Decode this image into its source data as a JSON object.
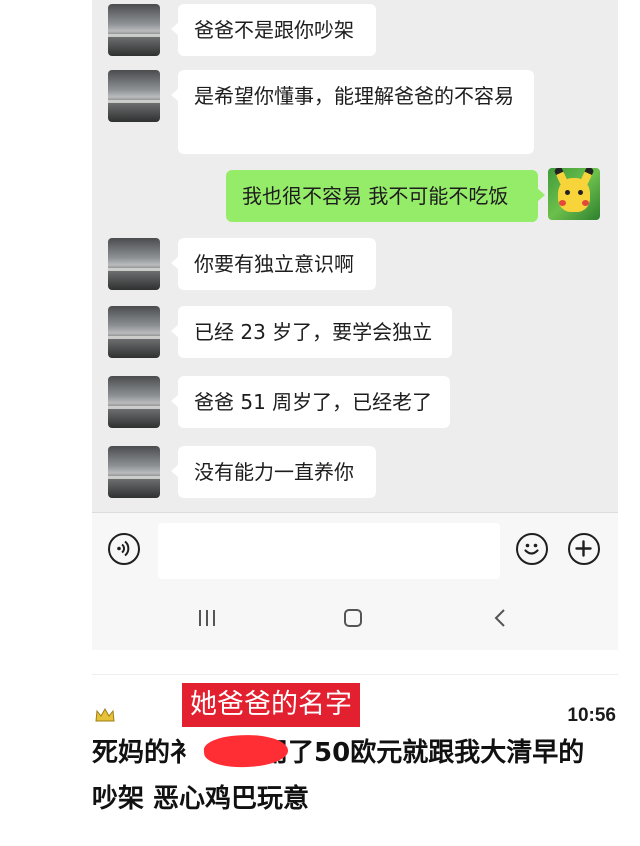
{
  "chat": {
    "messages": [
      {
        "from": "other",
        "text": "爸爸不是跟你吵架"
      },
      {
        "from": "other",
        "text": "是希望你懂事，能理解爸爸的不容易"
      },
      {
        "from": "me",
        "text": "我也很不容易 我不可能不吃饭"
      },
      {
        "from": "other",
        "text": "你要有独立意识啊"
      },
      {
        "from": "other",
        "text": "已经 23 岁了，要学会独立"
      },
      {
        "from": "other",
        "text": "爸爸 51 周岁了，已经老了"
      },
      {
        "from": "other",
        "text": "没有能力一直养你"
      }
    ]
  },
  "icons": {
    "voice": "voice-icon",
    "emoji": "emoji-icon",
    "plus": "plus-icon",
    "nav_recent": "recent-apps-icon",
    "nav_home": "home-icon",
    "nav_back": "back-icon"
  },
  "colors": {
    "chat_bg": "#ededed",
    "my_bubble": "#95ec69",
    "their_bubble": "#ffffff",
    "label_red": "#e3202f"
  },
  "post": {
    "time": "10:56",
    "label": "她爸爸的名字",
    "line1_part1": "死妈的",
    "line1_fragment": "衤",
    "line1_part2": "用了50欧元就跟我大清早的",
    "line2": "吵架 恶心鸡巴玩意"
  }
}
